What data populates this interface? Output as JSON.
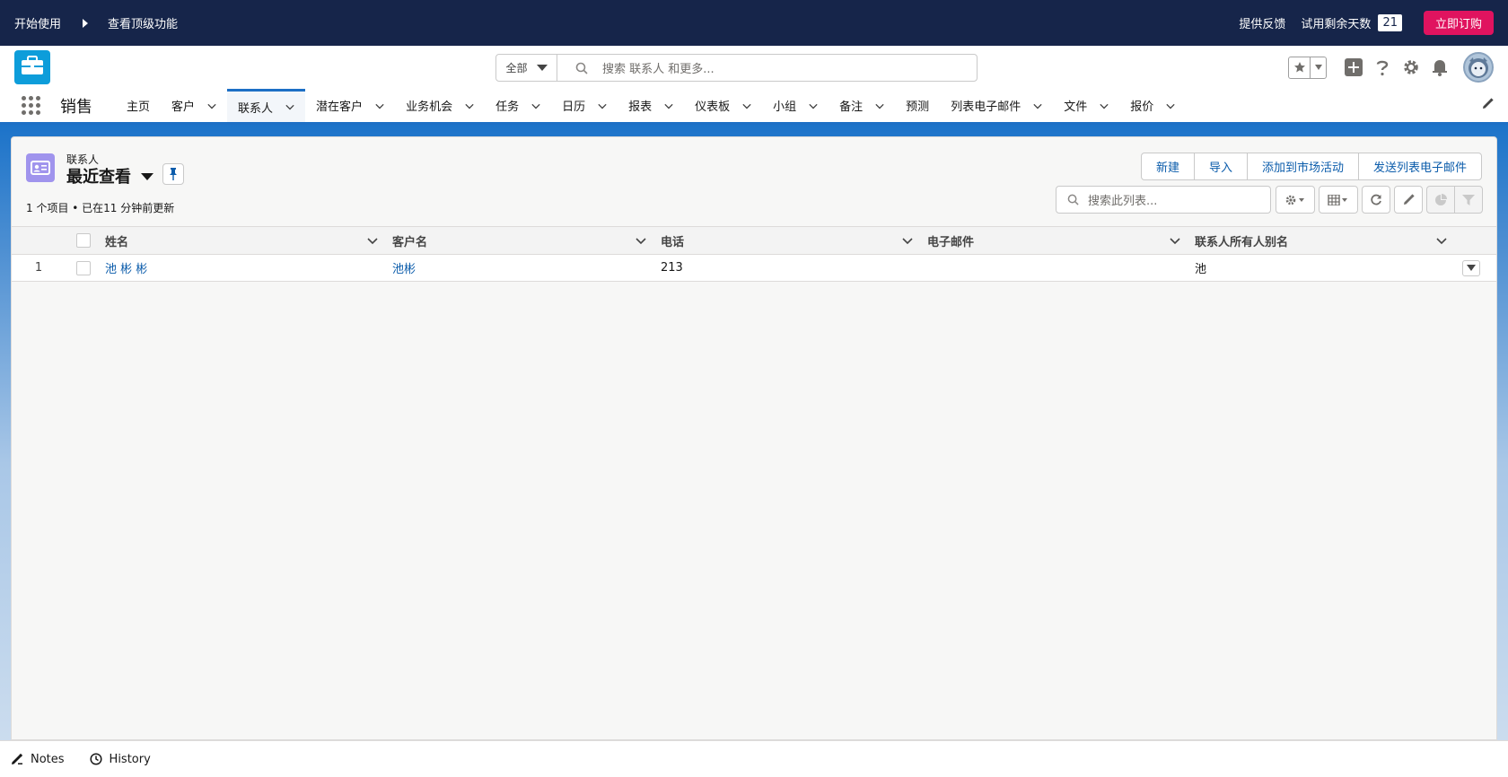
{
  "trial_bar": {
    "get_started": "开始使用",
    "top_features": "查看顶级功能",
    "feedback": "提供反馈",
    "days_left_label": "试用剩余天数",
    "days_left": "21",
    "subscribe": "立即订购"
  },
  "header": {
    "search_scope": "全部",
    "search_placeholder": "搜索 联系人 和更多..."
  },
  "app_nav": {
    "app_name": "销售",
    "items": [
      {
        "label": "主页",
        "has_menu": false
      },
      {
        "label": "客户",
        "has_menu": true
      },
      {
        "label": "联系人",
        "has_menu": true,
        "active": true
      },
      {
        "label": "潜在客户",
        "has_menu": true
      },
      {
        "label": "业务机会",
        "has_menu": true
      },
      {
        "label": "任务",
        "has_menu": true
      },
      {
        "label": "日历",
        "has_menu": true
      },
      {
        "label": "报表",
        "has_menu": true
      },
      {
        "label": "仪表板",
        "has_menu": true
      },
      {
        "label": "小组",
        "has_menu": true
      },
      {
        "label": "备注",
        "has_menu": true
      },
      {
        "label": "预测",
        "has_menu": false
      },
      {
        "label": "列表电子邮件",
        "has_menu": true
      },
      {
        "label": "文件",
        "has_menu": true
      },
      {
        "label": "报价",
        "has_menu": true
      }
    ]
  },
  "list_view": {
    "object_label": "联系人",
    "title": "最近查看",
    "meta": "1 个项目 • 已在11 分钟前更新",
    "buttons": {
      "new": "新建",
      "import": "导入",
      "add_to_campaign": "添加到市场活动",
      "send_list_email": "发送列表电子邮件"
    },
    "search_placeholder": "搜索此列表...",
    "columns": {
      "name": "姓名",
      "account": "客户名",
      "phone": "电话",
      "email": "电子邮件",
      "owner_alias": "联系人所有人别名"
    },
    "rows": [
      {
        "num": "1",
        "name": "池 彬 彬",
        "account": "池彬",
        "phone": "213",
        "email": "",
        "owner_alias": "池"
      }
    ]
  },
  "utility_bar": {
    "notes": "Notes",
    "history": "History"
  },
  "colors": {
    "trial_bar_bg": "#16254a",
    "subscribe_bg": "#e0135f",
    "brand_blue": "#1d6fc5",
    "link_blue": "#0b5cab",
    "contact_icon": "#a094ed"
  }
}
